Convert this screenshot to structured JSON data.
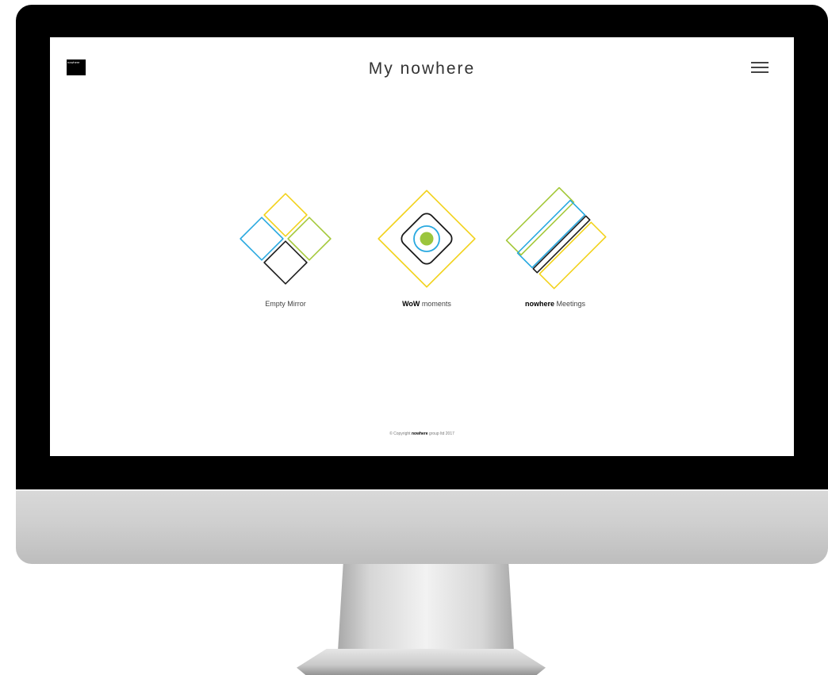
{
  "header": {
    "logo_text": "nowhere",
    "title": "My nowhere",
    "menu_icon": "hamburger-menu-icon"
  },
  "tiles": [
    {
      "label": "Empty Mirror",
      "icon": "empty-mirror-icon"
    },
    {
      "label_bold": "WoW",
      "label_rest": " moments",
      "icon": "wow-moments-icon"
    },
    {
      "label_bold": "nowhere",
      "label_rest": " Meetings",
      "icon": "nowhere-meetings-icon"
    }
  ],
  "footer": {
    "prefix": "© Copyright ",
    "brand": "nowhere",
    "suffix": " group ltd 2017"
  },
  "colors": {
    "yellow": "#f2d21b",
    "green": "#a5c93b",
    "blue": "#29a9e0",
    "black": "#1a1a1a",
    "green_fill": "#9bc53d"
  }
}
